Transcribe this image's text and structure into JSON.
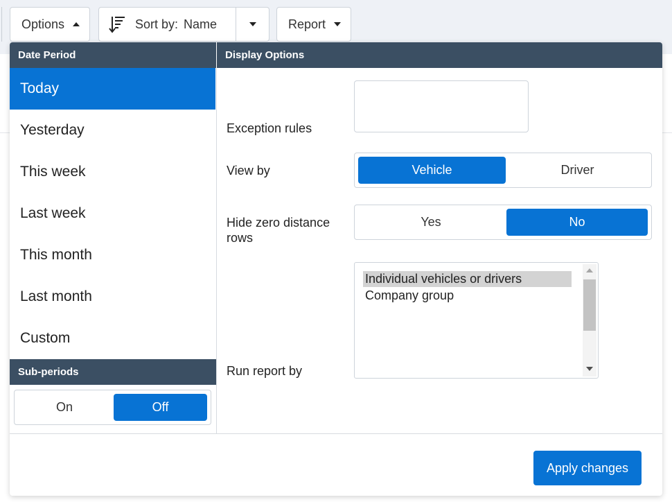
{
  "toolbar": {
    "options_label": "Options",
    "sort_prefix": "Sort by:",
    "sort_value": "Name",
    "report_label": "Report"
  },
  "date_period": {
    "header": "Date Period",
    "items": [
      {
        "label": "Today",
        "selected": true
      },
      {
        "label": "Yesterday",
        "selected": false
      },
      {
        "label": "This week",
        "selected": false
      },
      {
        "label": "Last week",
        "selected": false
      },
      {
        "label": "This month",
        "selected": false
      },
      {
        "label": "Last month",
        "selected": false
      },
      {
        "label": "Custom",
        "selected": false
      }
    ]
  },
  "sub_periods": {
    "header": "Sub-periods",
    "on_label": "On",
    "off_label": "Off",
    "selected": "Off"
  },
  "display_options": {
    "header": "Display Options",
    "exception_rules_label": "Exception rules",
    "exception_rules_value": "",
    "view_by": {
      "label": "View by",
      "options": [
        "Vehicle",
        "Driver"
      ],
      "selected": "Vehicle"
    },
    "hide_zero": {
      "label": "Hide zero distance rows",
      "options": [
        "Yes",
        "No"
      ],
      "selected": "No"
    },
    "run_report_by": {
      "label": "Run report by",
      "options": [
        "Individual vehicles or drivers",
        "Company group"
      ],
      "selected": "Individual vehicles or drivers"
    }
  },
  "apply_label": "Apply changes",
  "colors": {
    "accent": "#0873d4",
    "header_bg": "#3b4f63",
    "toolbar_bg": "#eef1f6"
  }
}
